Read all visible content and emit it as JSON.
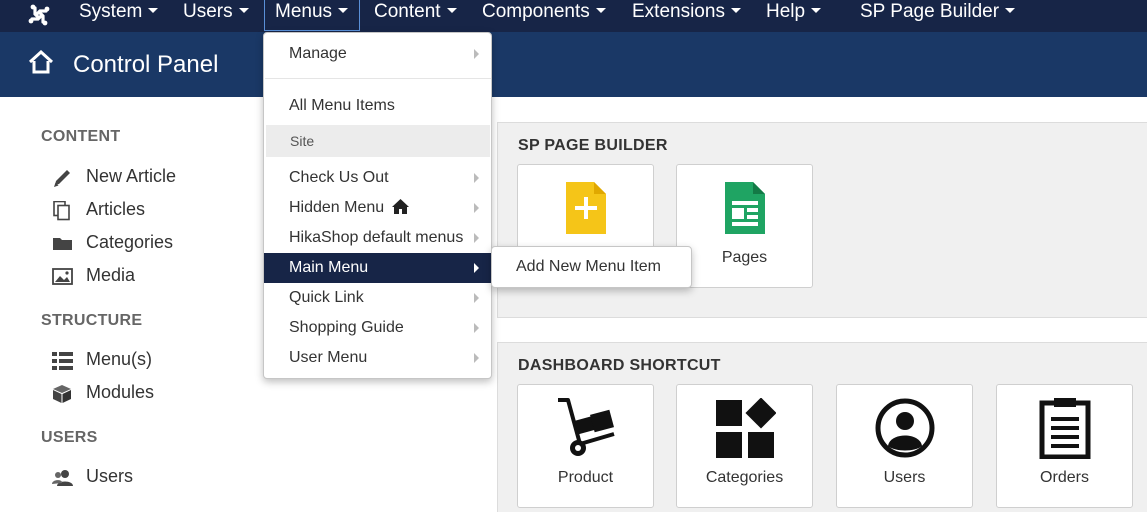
{
  "navbar": {
    "logo_icon": "joomla-logo-icon",
    "items": [
      {
        "label": "System"
      },
      {
        "label": "Users"
      },
      {
        "label": "Menus"
      },
      {
        "label": "Content"
      },
      {
        "label": "Components"
      },
      {
        "label": "Extensions"
      },
      {
        "label": "Help"
      },
      {
        "label": "SP Page Builder"
      }
    ]
  },
  "header": {
    "title": "Control Panel",
    "icon": "home-icon"
  },
  "sidebar": {
    "sections": [
      {
        "heading": "CONTENT",
        "items": [
          {
            "label": "New Article",
            "icon": "pencil-icon"
          },
          {
            "label": "Articles",
            "icon": "copy-icon"
          },
          {
            "label": "Categories",
            "icon": "folder-icon"
          },
          {
            "label": "Media",
            "icon": "image-icon"
          }
        ]
      },
      {
        "heading": "STRUCTURE",
        "items": [
          {
            "label": "Menu(s)",
            "icon": "list-icon"
          },
          {
            "label": "Modules",
            "icon": "cube-icon"
          }
        ]
      },
      {
        "heading": "USERS",
        "items": [
          {
            "label": "Users",
            "icon": "users-icon"
          }
        ]
      }
    ]
  },
  "menus_dropdown": {
    "manage": "Manage",
    "all_items": "All Menu Items",
    "site_header": "Site",
    "items": [
      {
        "label": "Check Us Out"
      },
      {
        "label": "Hidden Menu"
      },
      {
        "label": "HikaShop default menus"
      },
      {
        "label": "Main Menu"
      },
      {
        "label": "Quick Link"
      },
      {
        "label": "Shopping Guide"
      },
      {
        "label": "User Menu"
      }
    ],
    "hidden_menu_icon": "home-icon",
    "highlighted": "Main Menu"
  },
  "submenu": {
    "label": "Add New Menu Item"
  },
  "sp_panel": {
    "title": "SP PAGE BUILDER",
    "tiles": [
      {
        "label": "",
        "icon": "add-page-icon"
      },
      {
        "label": "Pages",
        "icon": "pages-icon"
      }
    ]
  },
  "shortcut_panel": {
    "title": "DASHBOARD SHORTCUT",
    "tiles": [
      {
        "label": "Product",
        "icon": "hand-truck-icon"
      },
      {
        "label": "Categories",
        "icon": "categories-icon"
      },
      {
        "label": "Users",
        "icon": "user-circle-icon"
      },
      {
        "label": "Orders",
        "icon": "clipboard-icon"
      }
    ]
  },
  "colors": {
    "navbar": "#172547",
    "subhead": "#1a3866",
    "highlight": "#172547",
    "add_page_yellow": "#f5c518",
    "pages_green": "#1fa463"
  }
}
